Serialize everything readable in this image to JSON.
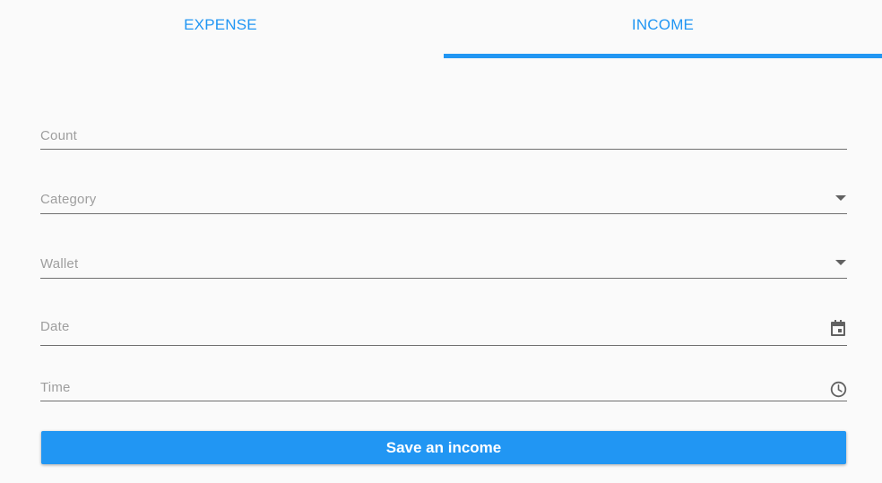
{
  "tabs": [
    {
      "label": "EXPENSE",
      "selected": false
    },
    {
      "label": "INCOME",
      "selected": true
    }
  ],
  "form": {
    "count": {
      "label": "Count"
    },
    "category": {
      "label": "Category",
      "icon": "dropdown-arrow-icon"
    },
    "wallet": {
      "label": "Wallet",
      "icon": "dropdown-arrow-icon"
    },
    "date": {
      "label": "Date",
      "icon": "calendar-icon"
    },
    "time": {
      "label": "Time",
      "icon": "clock-icon"
    }
  },
  "save_button": {
    "label": "Save an income"
  },
  "colors": {
    "accent": "#2196f3",
    "background": "#fafafa",
    "label": "#9e9e9e",
    "underline": "#6f6f6f",
    "icon": "#616161"
  }
}
